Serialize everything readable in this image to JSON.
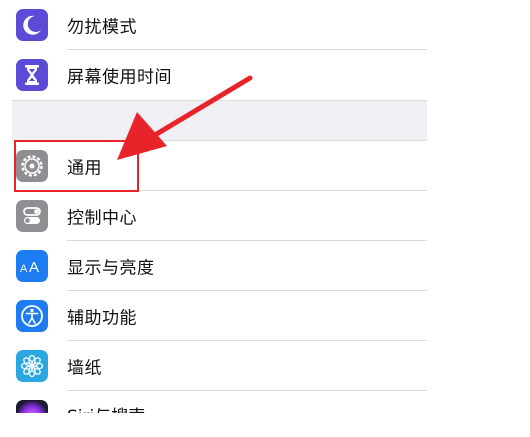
{
  "settings": {
    "items": [
      {
        "label": "勿扰模式",
        "icon": "moon-icon",
        "icon_color": "#5b4bd6"
      },
      {
        "label": "屏幕使用时间",
        "icon": "hourglass-icon",
        "icon_color": "#5b4bd6"
      },
      {
        "label": "通用",
        "icon": "gear-icon",
        "icon_color": "#8e8e93"
      },
      {
        "label": "控制中心",
        "icon": "toggles-icon",
        "icon_color": "#8e8e93"
      },
      {
        "label": "显示与亮度",
        "icon": "text-size-icon",
        "icon_color": "#1e7cf2"
      },
      {
        "label": "辅助功能",
        "icon": "accessibility-icon",
        "icon_color": "#1e7cf2"
      },
      {
        "label": "墙纸",
        "icon": "flower-icon",
        "icon_color": "#2aa7e0"
      },
      {
        "label": "Siri与搜索",
        "icon": "siri-icon",
        "icon_color": "#7b2bd6"
      }
    ]
  },
  "annotation": {
    "highlight_color": "#e8242a",
    "arrow_color": "#e8242a"
  }
}
